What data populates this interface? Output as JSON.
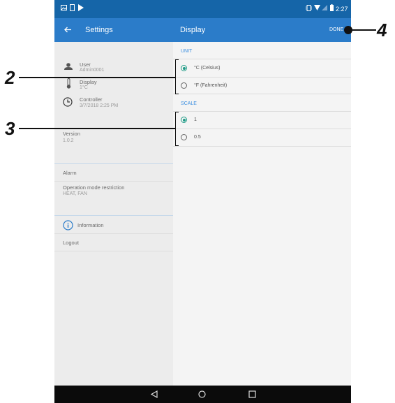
{
  "status_bar": {
    "time": "2:27"
  },
  "app_bar": {
    "back_icon": "arrow-back-icon",
    "left_title": "Settings",
    "right_title": "Display",
    "done_label": "DONE"
  },
  "left_panel": {
    "items": [
      {
        "label": "User",
        "value": "Admin0001",
        "icon": "person-icon"
      },
      {
        "label": "Display",
        "value": "1°C",
        "icon": "thermometer-icon"
      },
      {
        "label": "Controller",
        "value": "3/7/2018 2:25 PM",
        "icon": "clock-icon"
      }
    ],
    "version_label": "Version",
    "version_value": "1.0.2",
    "alarm_label": "Alarm",
    "opmode_label": "Operation mode restriction",
    "opmode_value": "HEAT, FAN",
    "information_label": "Information",
    "logout_label": "Logout"
  },
  "right_panel": {
    "unit_section": "UNIT",
    "unit_options": [
      {
        "label": "°C (Celsius)",
        "selected": true
      },
      {
        "label": "°F (Fahrenheit)",
        "selected": false
      }
    ],
    "scale_section": "SCALE",
    "scale_options": [
      {
        "label": "1",
        "selected": true
      },
      {
        "label": "0.5",
        "selected": false
      }
    ]
  },
  "callouts": [
    "2",
    "3",
    "4"
  ],
  "colors": {
    "status": "#1565a8",
    "appbar": "#2b7cc9",
    "accent": "#1e9b86",
    "section": "#3a8ee0"
  }
}
